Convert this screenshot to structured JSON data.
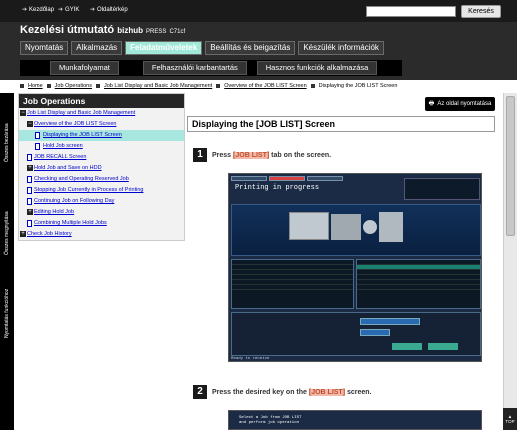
{
  "topbar": {
    "links": [
      "Kezdőlap",
      "GYIK",
      "Oldaltérkép"
    ],
    "search_placeholder": "",
    "search_button": "Keresés"
  },
  "header": {
    "title": "Kezelési útmutató",
    "product": "bizhub",
    "product2": "PRESS",
    "model": "C71cf",
    "nav1": [
      "Nyomtatás",
      "Alkalmazás",
      "Feladatműveletek",
      "Beállítás és beigazítás",
      "Készülék információk"
    ],
    "nav1_active": 2,
    "nav2": [
      "Munkafolyamat",
      "Felhasználói karbantartás",
      "Hasznos funkciók alkalmazása"
    ]
  },
  "breadcrumb": [
    "Home",
    "Job Operations",
    "Job List Display and Basic Job Management",
    "Overview of the JOB LIST Screen",
    "Displaying the JOB LIST Screen"
  ],
  "sidetabs": [
    "Összes bezárása",
    "Összes megnyitása",
    "Nyomtatás funkcióhoz"
  ],
  "left_panel": {
    "title": "Job Operations",
    "items": [
      {
        "label": "Job List Display and Basic Job Management",
        "icon": "minus",
        "level": 0
      },
      {
        "label": "Overview of the JOB LIST Screen",
        "icon": "minus",
        "level": 1
      },
      {
        "label": "Displaying the JOB LIST Screen",
        "icon": "page",
        "level": 2,
        "selected": true
      },
      {
        "label": "Hold Job screen",
        "icon": "page",
        "level": 2
      },
      {
        "label": "JOB RECALL Screen",
        "icon": "page",
        "level": 1
      },
      {
        "label": "Hold Job and Save on HDD",
        "icon": "plus",
        "level": 1
      },
      {
        "label": "Checking and Operating Reserved Job",
        "icon": "page",
        "level": 1
      },
      {
        "label": "Stopping Job Currently in Process of Printing",
        "icon": "page",
        "level": 1
      },
      {
        "label": "Continuing Job on Following Day",
        "icon": "page",
        "level": 1
      },
      {
        "label": "Editing Hold Job",
        "icon": "plus",
        "level": 1
      },
      {
        "label": "Combining Multiple Hold Jobs",
        "icon": "page",
        "level": 1
      },
      {
        "label": "Check Job History",
        "icon": "plus",
        "level": 0
      }
    ]
  },
  "main": {
    "print_button": "Az oldal nyomtatása",
    "page_title": "Displaying the [JOB LIST] Screen",
    "steps": [
      {
        "num": "1",
        "pre": "Press ",
        "highlight": "[JOB LIST]",
        "post": " tab on the screen."
      },
      {
        "num": "2",
        "pre": "Press the desired key on the ",
        "highlight": "[JOB LIST]",
        "post": " screen."
      }
    ]
  },
  "screenshot": {
    "title": "Printing in progress",
    "status": "Ready to receive",
    "line1": "Select a Job from JOB LIST",
    "line2": "and perform job operation"
  },
  "scroll": {
    "top_label": "TOP"
  },
  "colors": {
    "accent": "#a0e8d8",
    "selected_item": "#a8e6e0",
    "highlight": "#f4b8a8"
  }
}
